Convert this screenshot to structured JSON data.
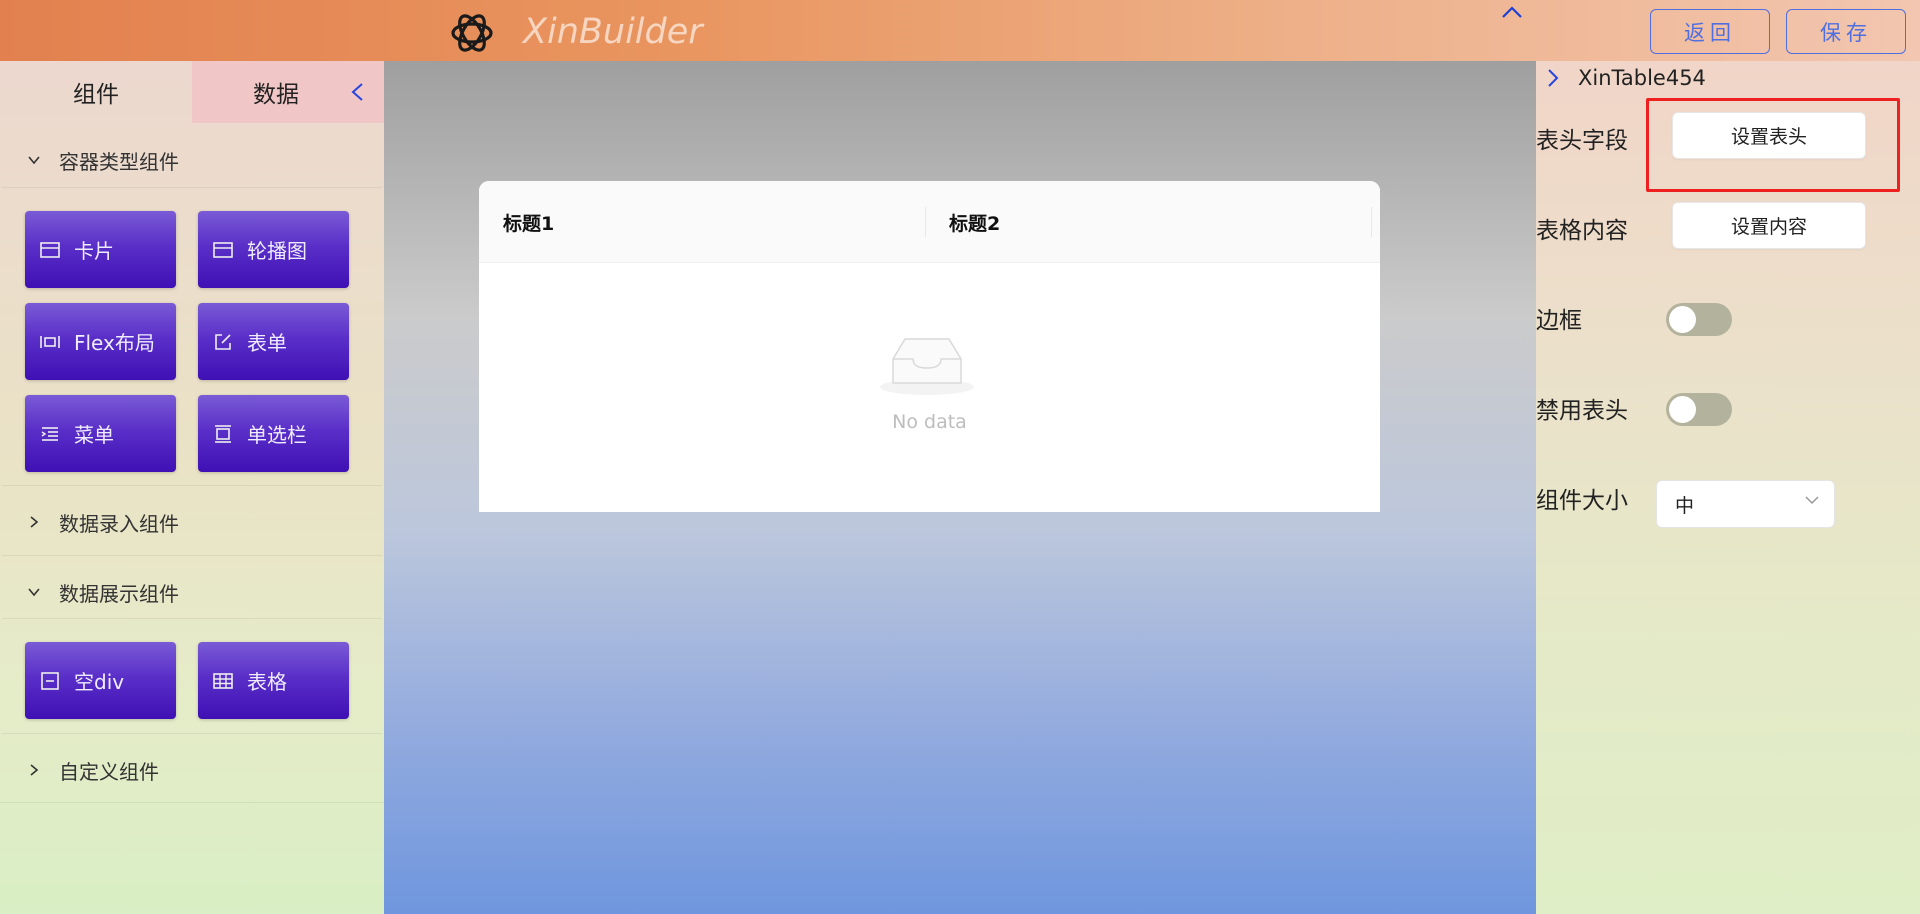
{
  "header": {
    "app_title": "XinBuilder",
    "back_label": "返回",
    "save_label": "保存"
  },
  "sidebar": {
    "tabs": [
      "组件",
      "数据"
    ],
    "categories": [
      {
        "label": "容器类型组件",
        "expanded": true,
        "items": [
          {
            "label": "卡片",
            "icon": "card-icon"
          },
          {
            "label": "轮播图",
            "icon": "carousel-icon"
          },
          {
            "label": "Flex布局",
            "icon": "flex-layout-icon"
          },
          {
            "label": "表单",
            "icon": "form-edit-icon"
          },
          {
            "label": "菜单",
            "icon": "menu-icon"
          },
          {
            "label": "单选栏",
            "icon": "radio-bar-icon"
          }
        ]
      },
      {
        "label": "数据录入组件",
        "expanded": false,
        "items": []
      },
      {
        "label": "数据展示组件",
        "expanded": true,
        "items": [
          {
            "label": "空div",
            "icon": "empty-div-icon"
          },
          {
            "label": "表格",
            "icon": "table-icon"
          }
        ]
      },
      {
        "label": "自定义组件",
        "expanded": false,
        "items": []
      }
    ]
  },
  "canvas": {
    "table": {
      "columns": [
        "标题1",
        "标题2"
      ],
      "empty_text": "No data"
    }
  },
  "properties": {
    "component_name": "XinTable454",
    "header_fields_label": "表头字段",
    "header_fields_button": "设置表头",
    "content_label": "表格内容",
    "content_button": "设置内容",
    "border_label": "边框",
    "border_on": false,
    "disable_header_label": "禁用表头",
    "disable_header_on": false,
    "size_label": "组件大小",
    "size_value": "中"
  },
  "colors": {
    "accent": "#4f6fe0",
    "component_button": "#4a1cbc",
    "highlight": "#ee2020"
  }
}
